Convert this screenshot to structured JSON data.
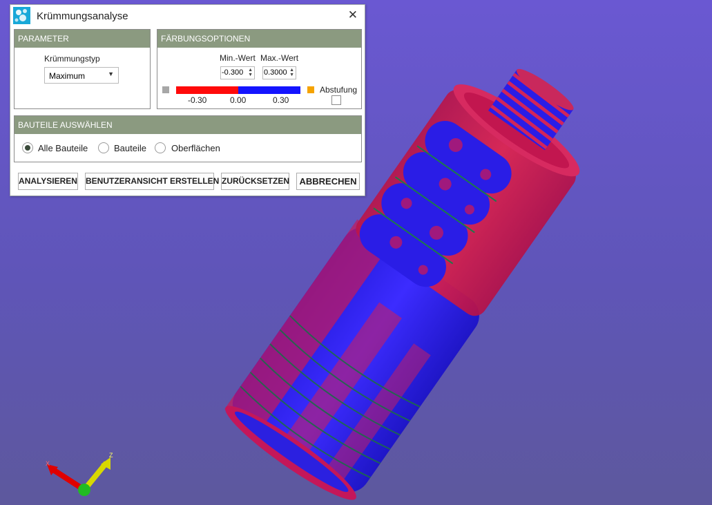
{
  "window": {
    "title": "Krümmungsanalyse",
    "close_glyph": "✕"
  },
  "parameter": {
    "header": "PARAMETER",
    "curvature_type_label": "Krümmungstyp",
    "curvature_type_value": "Maximum"
  },
  "coloring": {
    "header": "FÄRBUNGSOPTIONEN",
    "min_label": "Min.-Wert",
    "max_label": "Max.-Wert",
    "min_value": "-0.300",
    "max_value": "0.3000",
    "scale_ticks": [
      "-0.30",
      "0.00",
      "0.30"
    ],
    "low_color": "#a7a7a7",
    "high_color": "#f5a300",
    "gradient_colors": [
      "#ff0a0a",
      "#1414ff"
    ],
    "stepping_label": "Abstufung",
    "stepping_checked": false
  },
  "select_parts": {
    "header": "BAUTEILE AUSWÄHLEN",
    "options": [
      "Alle Bauteile",
      "Bauteile",
      "Oberflächen"
    ],
    "selected": "Alle Bauteile"
  },
  "buttons": {
    "analyze": "ANALYSIEREN",
    "create_view": "BENUTZERANSICHT ERSTELLEN",
    "reset": "ZURÜCKSETZEN",
    "cancel": "ABBRECHEN"
  },
  "axes": {
    "x_label": "X",
    "z_label": "Z"
  },
  "colors": {
    "header_bg": "#8b9a80",
    "background_top": "#6a58d2",
    "background_bottom": "#5d589d"
  }
}
